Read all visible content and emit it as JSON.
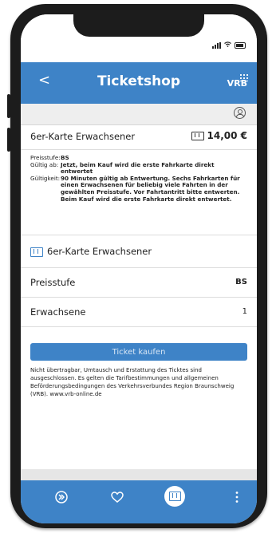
{
  "header": {
    "back_label": "<",
    "title": "Ticketshop",
    "logo_text": "VRB"
  },
  "ticket": {
    "name": "6er-Karte Erwachsener",
    "price": "14,00 €"
  },
  "details": [
    {
      "label": "Preisstufe:",
      "value": "BS"
    },
    {
      "label": "Gültig ab:",
      "value": "Jetzt, beim Kauf wird die erste Fahrkarte direkt entwertet"
    },
    {
      "label": "Gültigkeit:",
      "value": "90 Minuten gültig ab Entwertung. Sechs Fahrkarten für einen Erwachsenen für beliebig viele Fahrten in der gewählten Preisstufe. Vor Fahrtantritt bitte entwerten. Beim Kauf wird die erste Fahrkarte direkt entwertet."
    }
  ],
  "options": {
    "ticket_label": "6er-Karte Erwachsener",
    "preisstufe_label": "Preisstufe",
    "preisstufe_value": "BS",
    "erwachsene_label": "Erwachsene",
    "erwachsene_value": "1"
  },
  "buy_button": "Ticket kaufen",
  "footnote": "Nicht übertragbar, Umtausch und Erstattung des Ticktes sind ausgeschlossen. Es gelten die Tarifbestimmungen und allgemeinen Beförderungsbedingungen des Verkehrsverbundes Region Braunschweig (VRB). www.vrb-online.de",
  "colors": {
    "accent": "#3e83c7",
    "frame": "#1c1c1c"
  },
  "nav": {
    "icons": [
      "swap-icon",
      "heart-icon",
      "ticket-icon",
      "more-icon"
    ],
    "active": "ticket-icon"
  }
}
